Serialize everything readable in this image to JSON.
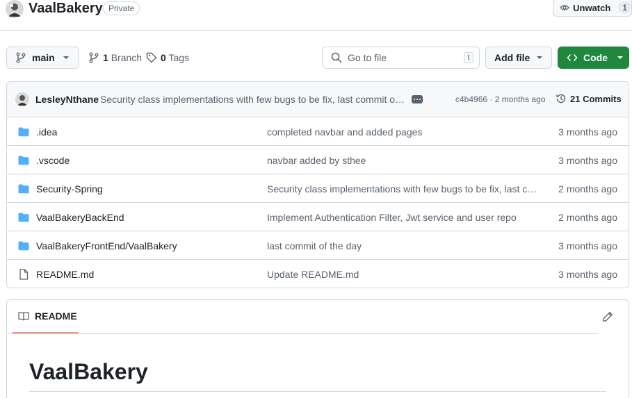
{
  "repo": {
    "name": "VaalBakery",
    "visibility": "Private",
    "unwatch_label": "Unwatch",
    "watch_count": "1"
  },
  "toolbar": {
    "branch": "main",
    "branches_count": "1",
    "branches_label": "Branch",
    "tags_count": "0",
    "tags_label": "Tags",
    "search_placeholder": "Go to file",
    "search_shortcut": "t",
    "add_file_label": "Add file",
    "code_label": "Code"
  },
  "latest_commit": {
    "author": "LesleyNthane",
    "message": "Security class implementations with few bugs to be fix, last commit of the day",
    "hash_time": "c4b4966 · 2 months ago",
    "commits_label": "21 Commits"
  },
  "files": [
    {
      "name": ".idea",
      "type": "folder",
      "message": "completed navbar and added pages",
      "date": "3 months ago"
    },
    {
      "name": ".vscode",
      "type": "folder",
      "message": "navbar added by sthee",
      "date": "3 months ago"
    },
    {
      "name": "Security-Spring",
      "type": "folder",
      "message": "Security class implementations with few bugs to be fix, last commit of the day",
      "date": "2 months ago"
    },
    {
      "name": "VaalBakeryBackEnd",
      "type": "folder",
      "message": "Implement Authentication Filter, Jwt service and user repo",
      "date": "2 months ago"
    },
    {
      "name": "VaalBakeryFrontEnd/VaalBakery",
      "type": "folder",
      "message": "last commit of the day",
      "date": "3 months ago"
    },
    {
      "name": "README.md",
      "type": "file",
      "message": "Update README.md",
      "date": "3 months ago"
    }
  ],
  "readme": {
    "tab_label": "README",
    "heading": "VaalBakery"
  },
  "colors": {
    "accent_green": "#1f883d",
    "folder_blue": "#54aeff",
    "tab_underline": "#fd8c73"
  }
}
